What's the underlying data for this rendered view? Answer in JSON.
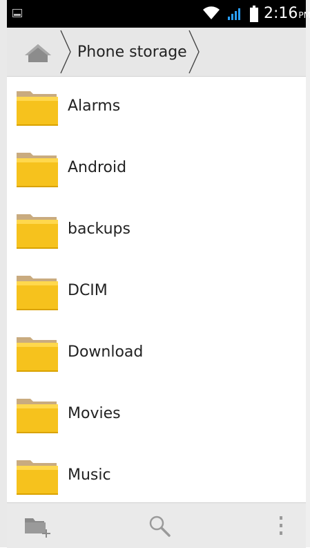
{
  "status_bar": {
    "time": "2:16",
    "ampm": "PM",
    "icons": [
      "notification-icon",
      "wifi-icon",
      "signal-icon",
      "battery-icon"
    ]
  },
  "breadcrumb": {
    "home_icon": "home-icon",
    "current": "Phone storage"
  },
  "folders": [
    {
      "name": "Alarms"
    },
    {
      "name": "Android"
    },
    {
      "name": "backups"
    },
    {
      "name": "DCIM"
    },
    {
      "name": "Download"
    },
    {
      "name": "Movies"
    },
    {
      "name": "Music"
    }
  ],
  "action_bar": {
    "icons": [
      "new-folder-icon",
      "search-icon",
      "overflow-menu-icon"
    ]
  },
  "colors": {
    "status_bar_bg": "#000000",
    "toolbar_bg": "#e7e7e7",
    "folder_yellow": "#f6c21d",
    "folder_tab": "#c9ab7f"
  }
}
